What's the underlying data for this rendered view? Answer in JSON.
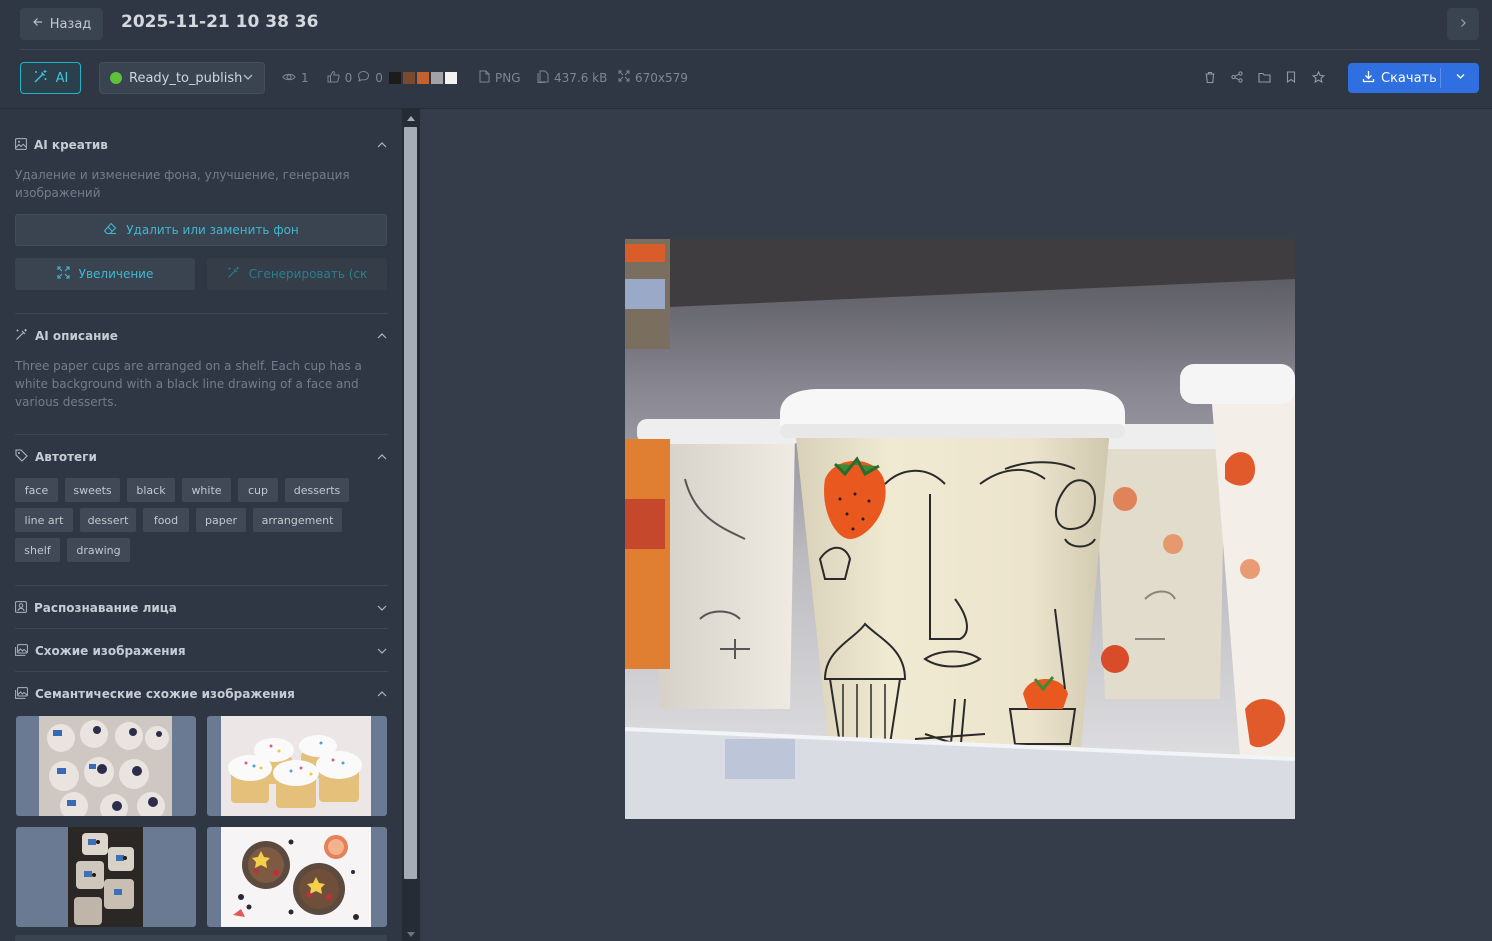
{
  "header": {
    "back_label": "Назад",
    "title": "2025-11-21 10 38 36"
  },
  "toolbar": {
    "ai_label": "AI",
    "status": {
      "value": "Ready_to_publish",
      "color": "#5fc13a"
    },
    "stats": {
      "views": "1",
      "likes": "0",
      "comments": "0"
    },
    "palette": [
      "#1c1c1c",
      "#7a4a2f",
      "#c2622e",
      "#a3a3a6",
      "#f2f2f2"
    ],
    "file_type": "PNG",
    "file_size": "437.6 kB",
    "dimensions": "670x579",
    "download_label": "Скачать",
    "accent": "#2f6fe0"
  },
  "panel": {
    "ai_creative": {
      "title": "AI креатив",
      "description": "Удаление и изменение фона, улучшение, генерация изображений",
      "remove_bg_label": "Удалить или заменить фон",
      "upscale_label": "Увеличение",
      "generate_label": "Сгенерировать (ск"
    },
    "ai_description": {
      "title": "AI описание",
      "text": "Three paper cups are arranged on a shelf. Each cup has a white background with a black line drawing of a face and various desserts."
    },
    "autotags": {
      "title": "Автотеги",
      "tags": [
        "face",
        "sweets",
        "black",
        "white",
        "cup",
        "desserts",
        "line art",
        "dessert",
        "food",
        "paper",
        "arrangement",
        "shelf",
        "drawing"
      ]
    },
    "face_recognition": {
      "title": "Распознавание лица"
    },
    "similar": {
      "title": "Схожие изображения"
    },
    "semantic_similar": {
      "title": "Семантические схожие изображения"
    }
  }
}
